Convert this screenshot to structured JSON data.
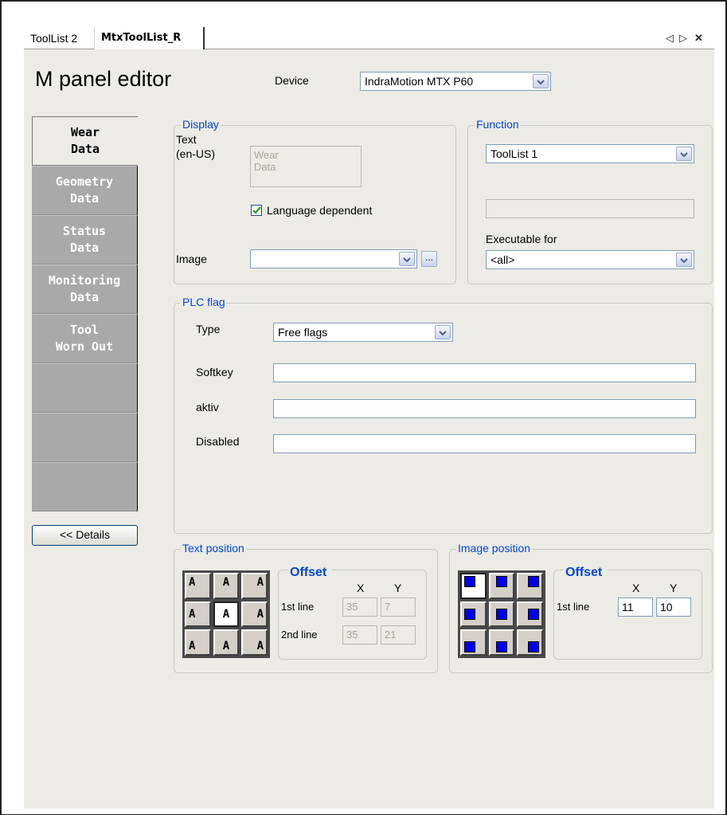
{
  "tabs": [
    {
      "label": "ToolList 2"
    },
    {
      "label": "MtxToolList_R"
    }
  ],
  "tab_controls": {
    "left": "◁",
    "right": "▷",
    "close": "✕"
  },
  "page_title": "M panel editor",
  "device": {
    "label": "Device",
    "value": "IndraMotion MTX P60"
  },
  "vertical_tabs": [
    {
      "line1": "Wear",
      "line2": "Data",
      "state": "active"
    },
    {
      "line1": "Geometry",
      "line2": "Data",
      "state": "inactive"
    },
    {
      "line1": "Status",
      "line2": "Data",
      "state": "inactive"
    },
    {
      "line1": "Monitoring",
      "line2": "Data",
      "state": "inactive"
    },
    {
      "line1": "Tool",
      "line2": "Worn Out",
      "state": "inactive"
    }
  ],
  "details_button": "<< Details",
  "display": {
    "title": "Display",
    "text_label_1": "Text",
    "text_label_2": "(en-US)",
    "text_value_1": "Wear",
    "text_value_2": "Data",
    "language_dependent_label": "Language dependent",
    "language_dependent_checked": true,
    "image_label": "Image",
    "image_value": "",
    "browse_label": "..."
  },
  "function": {
    "title": "Function",
    "value": "ToolList 1",
    "empty_value": "",
    "executable_label": "Executable for",
    "executable_value": "<all>"
  },
  "plc_flag": {
    "title": "PLC flag",
    "type_label": "Type",
    "type_value": "Free flags",
    "softkey_label": "Softkey",
    "softkey_value": "",
    "aktiv_label": "aktiv",
    "aktiv_value": "",
    "disabled_label": "Disabled",
    "disabled_value": ""
  },
  "text_position": {
    "title": "Text position",
    "grid_glyph": "A",
    "offset_title": "Offset",
    "x_label": "X",
    "y_label": "Y",
    "line1_label": "1st line",
    "line1_x": "35",
    "line1_y": "7",
    "line2_label": "2nd line",
    "line2_x": "35",
    "line2_y": "21"
  },
  "image_position": {
    "title": "Image position",
    "offset_title": "Offset",
    "x_label": "X",
    "y_label": "Y",
    "line1_label": "1st line",
    "line1_x": "11",
    "line1_y": "10"
  },
  "colors": {
    "accent_blue": "#0046d5",
    "marker_blue": "#0000ee",
    "panel_bg": "#ecebe5",
    "tab_gray": "#a9a9a9"
  }
}
